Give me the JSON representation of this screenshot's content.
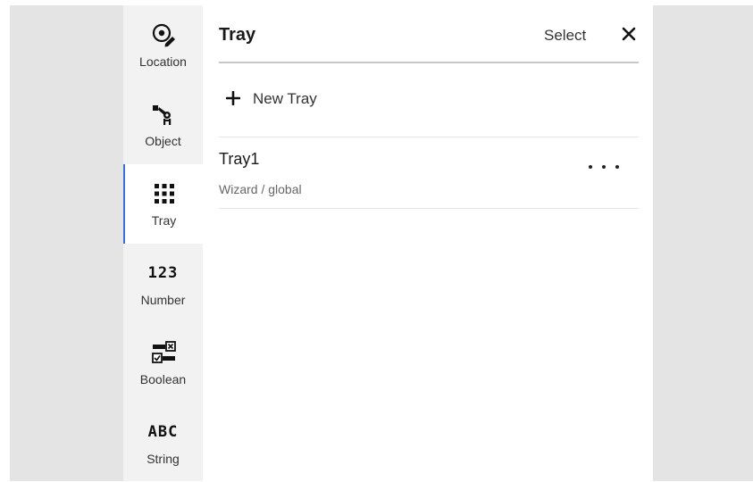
{
  "sidebar": {
    "items": [
      {
        "label": "Location",
        "icon": "location-icon",
        "active": false
      },
      {
        "label": "Object",
        "icon": "robot-gripper-icon",
        "active": false
      },
      {
        "label": "Tray",
        "icon": "grid-dots-icon",
        "active": true
      },
      {
        "label": "Number",
        "icon": "number-icon",
        "icon_text": "123",
        "active": false
      },
      {
        "label": "Boolean",
        "icon": "boolean-toggle-icon",
        "active": false
      },
      {
        "label": "String",
        "icon": "string-icon",
        "icon_text": "ABC",
        "active": false
      }
    ]
  },
  "panel": {
    "title": "Tray",
    "select_label": "Select",
    "close_icon": "close-icon",
    "new_item_label": "New Tray",
    "items": [
      {
        "name": "Tray1",
        "subtitle": "Wizard / global"
      }
    ]
  },
  "colors": {
    "accent": "#3b6fd8",
    "rail_bg": "#f2f2f2",
    "backdrop": "#e4e4e4"
  }
}
